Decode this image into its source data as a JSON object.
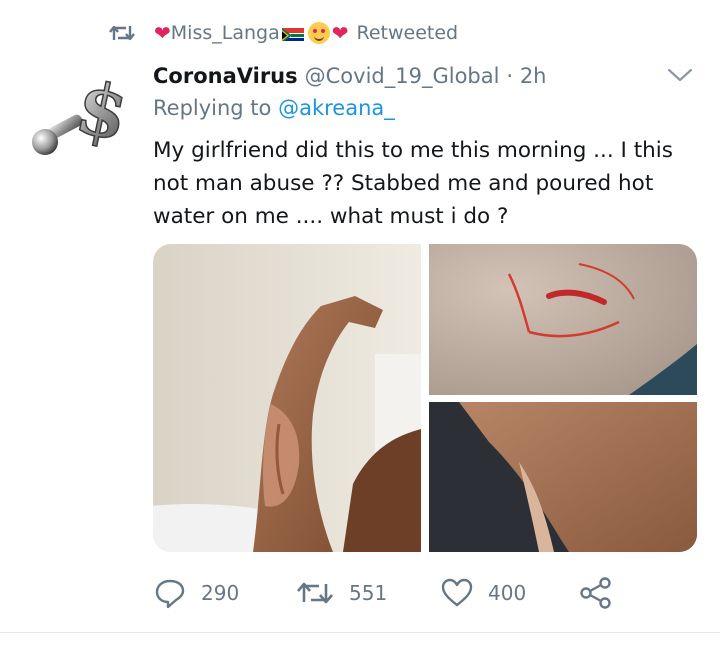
{
  "retweet_bar": {
    "heart_left": "❤",
    "name": "Miss_Langa",
    "heart_right": "❤",
    "label": "Retweeted"
  },
  "tweet": {
    "display_name": "CoronaVirus",
    "handle": "@Covid_19_Global",
    "time": "· 2h",
    "replying_prefix": "Replying to ",
    "replying_to": "@akreana_",
    "text": "My girlfriend did this to me this morning ... I this not man abuse ?? Stabbed me and poured hot water on me .... what must i do ?"
  },
  "actions": {
    "replies": "290",
    "retweets": "551",
    "likes": "400"
  },
  "colors": {
    "muted": "#657786",
    "link": "#1b95e0",
    "text": "#14171a",
    "heart": "#e0245e"
  },
  "icons": [
    "retweet-icon",
    "caret-down-icon",
    "reply-icon",
    "like-icon",
    "share-icon"
  ]
}
